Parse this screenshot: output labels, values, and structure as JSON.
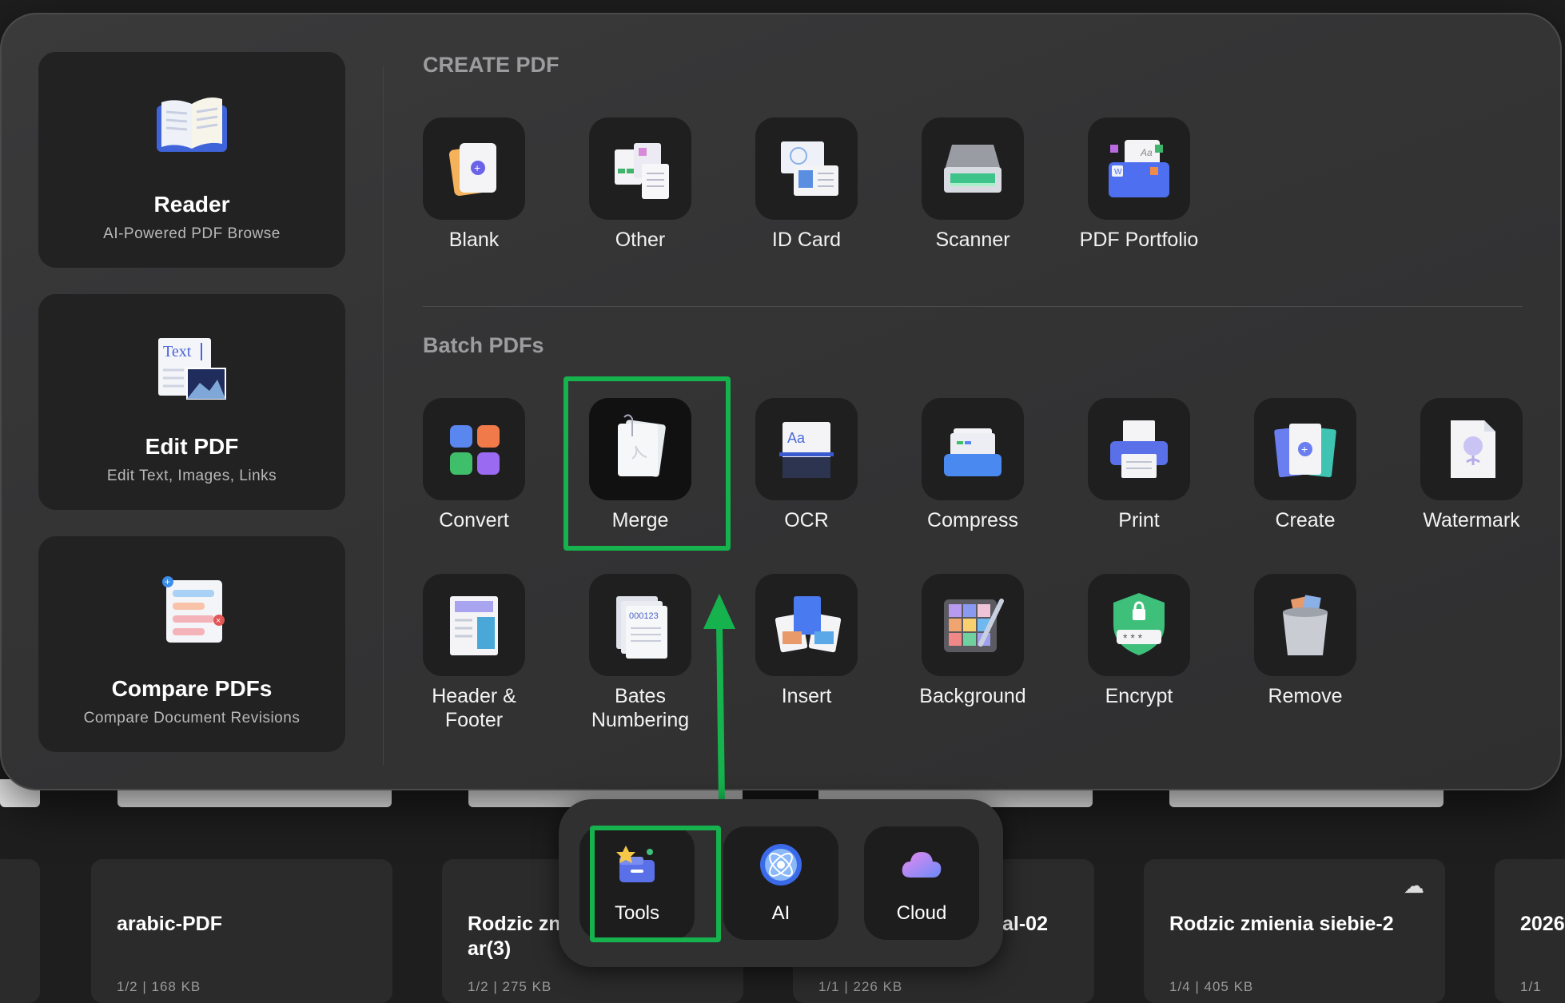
{
  "background_files": [
    {
      "name": "arabic-PDF",
      "meta": "1/2 | 168 KB"
    },
    {
      "name": "Rodzic zn ar(3)",
      "meta": "1/2 | 275 KB"
    },
    {
      "name": "al-02",
      "meta": "1/1 | 226 KB"
    },
    {
      "name": "Rodzic zmienia siebie-2",
      "meta": "1/4 | 405 KB"
    },
    {
      "name": "2026",
      "meta": "1/1"
    }
  ],
  "side_cards": [
    {
      "title": "Reader",
      "subtitle": "AI-Powered PDF Browse"
    },
    {
      "title": "Edit PDF",
      "subtitle": "Edit Text, Images, Links",
      "icon_text": "Text"
    },
    {
      "title": "Compare PDFs",
      "subtitle": "Compare Document Revisions"
    }
  ],
  "create_section": {
    "title": "CREATE PDF",
    "tools": [
      "Blank",
      "Other",
      "ID Card",
      "Scanner",
      "PDF Portfolio"
    ]
  },
  "batch_section": {
    "title": "Batch PDFs",
    "row1": [
      "Convert",
      "Merge",
      "OCR",
      "Compress",
      "Print",
      "Create",
      "Watermark"
    ],
    "row2": [
      "Header &\nFooter",
      "Bates\nNumbering",
      "Insert",
      "Background",
      "Encrypt",
      "Remove"
    ]
  },
  "bates_icon_text": "000123",
  "ocr_icon_text": "Aa",
  "dock": [
    "Tools",
    "AI",
    "Cloud"
  ],
  "colors": {
    "highlight": "#15b24d",
    "panel": "#353536",
    "tile": "#1f1f20"
  }
}
